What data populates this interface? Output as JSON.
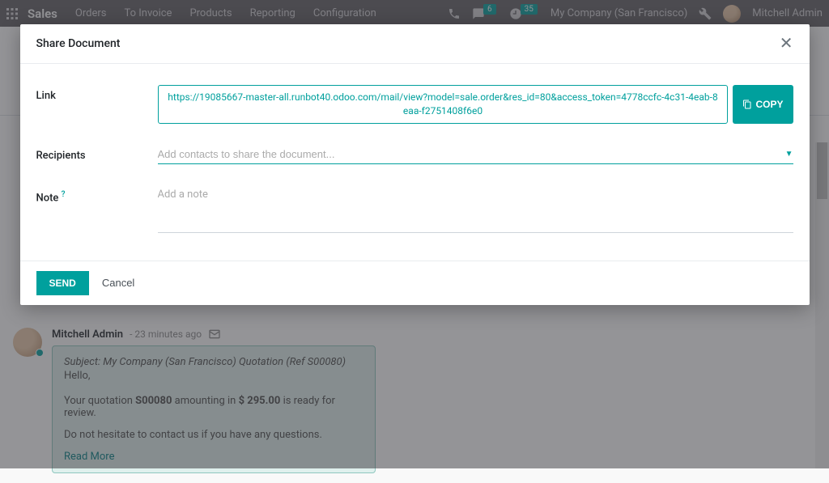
{
  "navbar": {
    "brand": "Sales",
    "links": [
      "Orders",
      "To Invoice",
      "Products",
      "Reporting",
      "Configuration"
    ],
    "messages_badge": "6",
    "activities_badge": "35",
    "company": "My Company (San Francisco)",
    "user": "Mitchell Admin"
  },
  "modal": {
    "title": "Share Document",
    "link_label": "Link",
    "link_value": "https://19085667-master-all.runbot40.odoo.com/mail/view?model=sale.order&res_id=80&access_token=4778ccfc-4c31-4eab-8eaa-f2751408f6e0",
    "copy_label": "COPY",
    "recipients_label": "Recipients",
    "recipients_placeholder": "Add contacts to share the document...",
    "note_label": "Note",
    "note_help": "?",
    "note_placeholder": "Add a note",
    "send_label": "Send",
    "cancel_label": "Cancel"
  },
  "message": {
    "author": "Mitchell Admin",
    "time": "23 minutes ago",
    "subject": "Subject: My Company (San Francisco) Quotation (Ref S00080)",
    "greeting": "Hello,",
    "line1_a": "Your quotation ",
    "line1_ref": "S00080",
    "line1_b": " amounting in ",
    "line1_amount": "$ 295.00",
    "line1_c": " is ready for review.",
    "line2": "Do not hesitate to contact us if you have any questions.",
    "readmore": "Read More"
  }
}
